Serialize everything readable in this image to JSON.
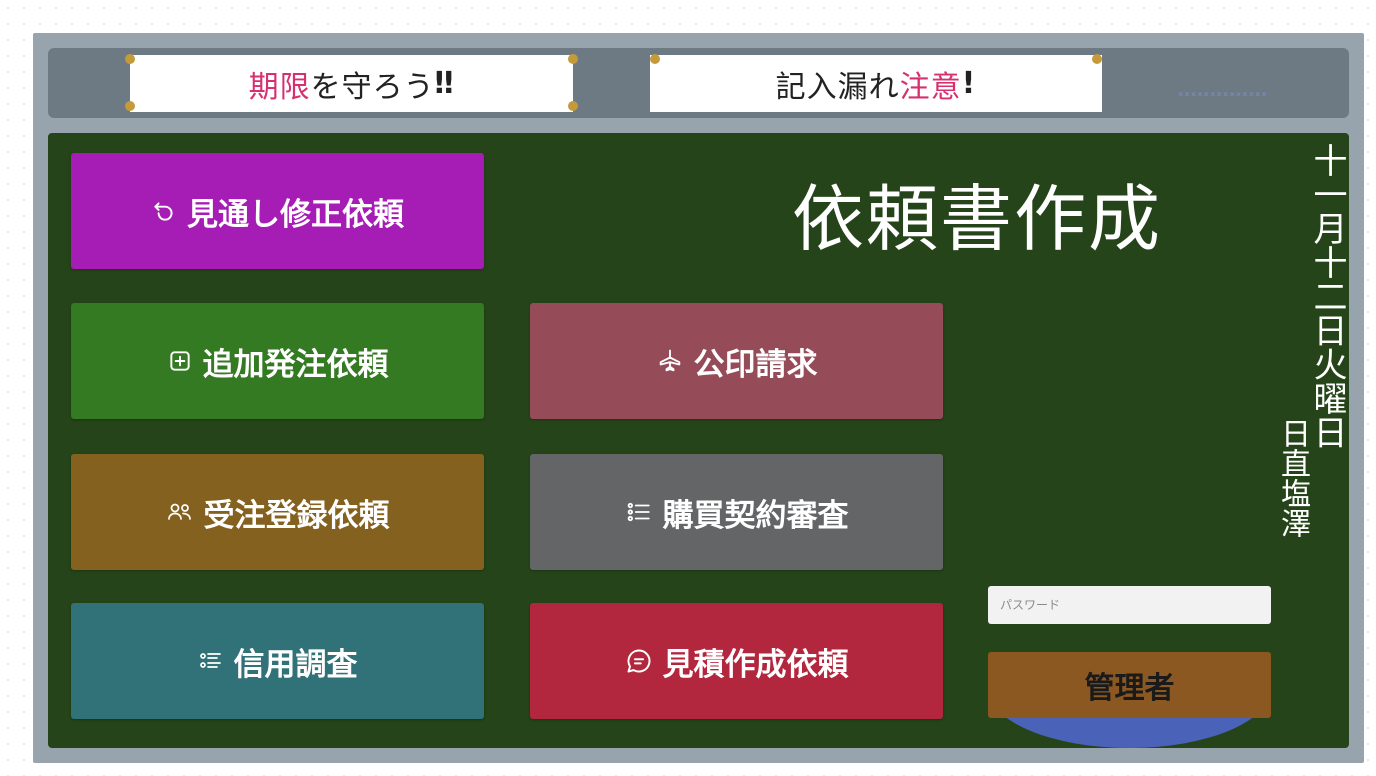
{
  "header": {
    "note1": {
      "accent": "期限",
      "rest": "を守ろう",
      "bang": "‼"
    },
    "note2": {
      "lead": "記入漏れ",
      "accent": "注意",
      "bang": "!"
    },
    "dots": "××××××××××××××"
  },
  "title": "依頼書作成",
  "buttons": [
    {
      "key": "mitoshi",
      "label": "見通し修正依頼",
      "icon": "undo-icon",
      "color": "#a51db5"
    },
    {
      "key": "tsuika",
      "label": "追加発注依頼",
      "icon": "add-square-icon",
      "color": "#337a22"
    },
    {
      "key": "koin",
      "label": "公印請求",
      "icon": "airplane-icon",
      "color": "#954b58"
    },
    {
      "key": "juchu",
      "label": "受注登録依頼",
      "icon": "users-icon",
      "color": "#84611e"
    },
    {
      "key": "kobai",
      "label": "購買契約審査",
      "icon": "list-icon",
      "color": "#636566"
    },
    {
      "key": "shinyo",
      "label": "信用調査",
      "icon": "list-filter-icon",
      "color": "#317178"
    },
    {
      "key": "mitsumori",
      "label": "見積作成依頼",
      "icon": "chat-icon",
      "color": "#b2273d"
    }
  ],
  "date": "十一月十二日火曜日",
  "duty": "日直塩澤",
  "password": {
    "placeholder": "パスワード",
    "value": ""
  },
  "admin": {
    "label": "管理者",
    "color": "#8c5822"
  },
  "colors": {
    "board": "#254419",
    "header": "#6e7a83",
    "frame": "#97a3ad",
    "accent": "#d6306f",
    "pin": "#c59a3a"
  }
}
